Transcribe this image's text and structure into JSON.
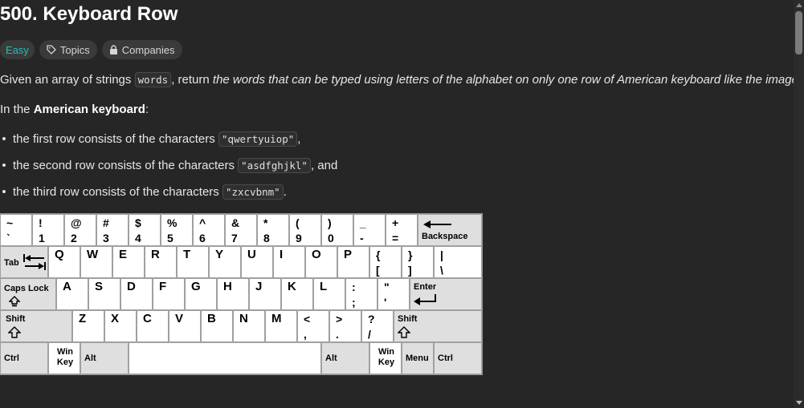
{
  "problem": {
    "title": "500. Keyboard Row",
    "difficulty": "Easy",
    "topics_label": "Topics",
    "companies_label": "Companies"
  },
  "description": {
    "p1_a": "Given an array of strings ",
    "p1_code": "words",
    "p1_b": ", return ",
    "p1_em": "the words that can be typed using letters of the alphabet on only one row of American keyboard like the image below",
    "p1_c": ".",
    "p2_a": "In the ",
    "p2_bold": "American keyboard",
    "p2_c": ":",
    "bullets": [
      {
        "pre": "the first row consists of the characters ",
        "code": "\"qwertyuiop\"",
        "post": ","
      },
      {
        "pre": "the second row consists of the characters ",
        "code": "\"asdfghjkl\"",
        "post": ", and"
      },
      {
        "pre": "the third row consists of the characters ",
        "code": "\"zxcvbnm\"",
        "post": "."
      }
    ]
  },
  "keyboard": {
    "row1": [
      {
        "top": "~",
        "bottom": "`"
      },
      {
        "top": "!",
        "bottom": "1"
      },
      {
        "top": "@",
        "bottom": "2"
      },
      {
        "top": "#",
        "bottom": "3"
      },
      {
        "top": "$",
        "bottom": "4"
      },
      {
        "top": "%",
        "bottom": "5"
      },
      {
        "top": "^",
        "bottom": "6"
      },
      {
        "top": "&",
        "bottom": "7"
      },
      {
        "top": "*",
        "bottom": "8"
      },
      {
        "top": "(",
        "bottom": "9"
      },
      {
        "top": ")",
        "bottom": "0"
      },
      {
        "top": "_",
        "bottom": "-"
      },
      {
        "top": "+",
        "bottom": "="
      }
    ],
    "backspace": "Backspace",
    "tab": "Tab",
    "row2_letters": [
      "Q",
      "W",
      "E",
      "R",
      "T",
      "Y",
      "U",
      "I",
      "O",
      "P"
    ],
    "row2_symbols": [
      {
        "top": "{",
        "bottom": "["
      },
      {
        "top": "}",
        "bottom": "]"
      },
      {
        "top": "|",
        "bottom": "\\"
      }
    ],
    "caps_lock": "Caps Lock",
    "row3_letters": [
      "A",
      "S",
      "D",
      "F",
      "G",
      "H",
      "J",
      "K",
      "L"
    ],
    "row3_symbols": [
      {
        "top": ":",
        "bottom": ";"
      },
      {
        "top": "\"",
        "bottom": "'"
      }
    ],
    "enter": "Enter",
    "shift": "Shift",
    "row4_letters": [
      "Z",
      "X",
      "C",
      "V",
      "B",
      "N",
      "M"
    ],
    "row4_symbols": [
      {
        "top": "<",
        "bottom": ","
      },
      {
        "top": ">",
        "bottom": "."
      },
      {
        "top": "?",
        "bottom": "/"
      }
    ],
    "ctrl": "Ctrl",
    "win": "Win",
    "key": "Key",
    "alt": "Alt",
    "menu": "Menu"
  }
}
